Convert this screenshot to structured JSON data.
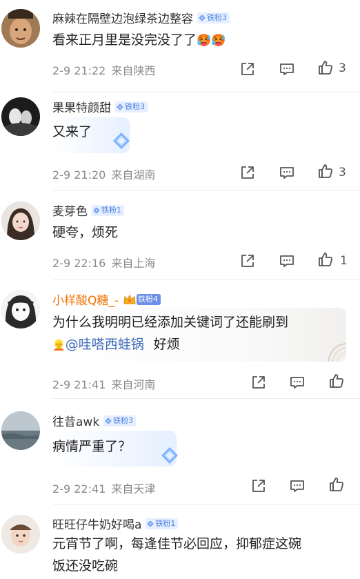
{
  "comments": [
    {
      "username": "麻辣在隔壁边泡绿茶边整容",
      "badge": "铁粉3",
      "text": "看来正月里是没完没了了",
      "emoji": "🥵🥵",
      "time": "2-9 21:22",
      "location": "来自陕西",
      "likes": "3"
    },
    {
      "username": "果果特颜甜",
      "badge": "铁粉3",
      "text": "又来了",
      "time": "2-9 21:20",
      "location": "来自湖南",
      "likes": "3"
    },
    {
      "username": "麦芽色",
      "badge": "铁粉1",
      "text": "硬夸，烦死",
      "time": "2-9 22:16",
      "location": "来自上海",
      "likes": "1"
    },
    {
      "username": "小样酸Q糖_-",
      "badge": "铁粉4",
      "text_line1": "为什么我明明已经添加关键词了还能刷到",
      "mention_emoji": "👱",
      "mention": "@哇嗒西蛙锅",
      "text_line2_tail": "好烦",
      "time": "2-9 21:41",
      "location": "来自河南",
      "likes": ""
    },
    {
      "username": "往昔awk",
      "badge": "铁粉3",
      "text": "病情严重了？",
      "time": "2-9 22:41",
      "location": "来自天津",
      "likes": ""
    },
    {
      "username": "旺旺仔牛奶好喝a",
      "badge": "铁粉1",
      "text_line1": "元宵节了啊，每逢佳节必回应，抑郁症这碗",
      "text_line2": "饭还没吃碗"
    }
  ],
  "colors": {
    "badge_bg": "#e6efff",
    "badge_text": "#4a7fe0",
    "vip_name": "#f27200",
    "meta": "#8a8a8a"
  },
  "icons": [
    "share-icon",
    "comment-icon",
    "like-icon",
    "diamond-icon",
    "crown-icon"
  ]
}
